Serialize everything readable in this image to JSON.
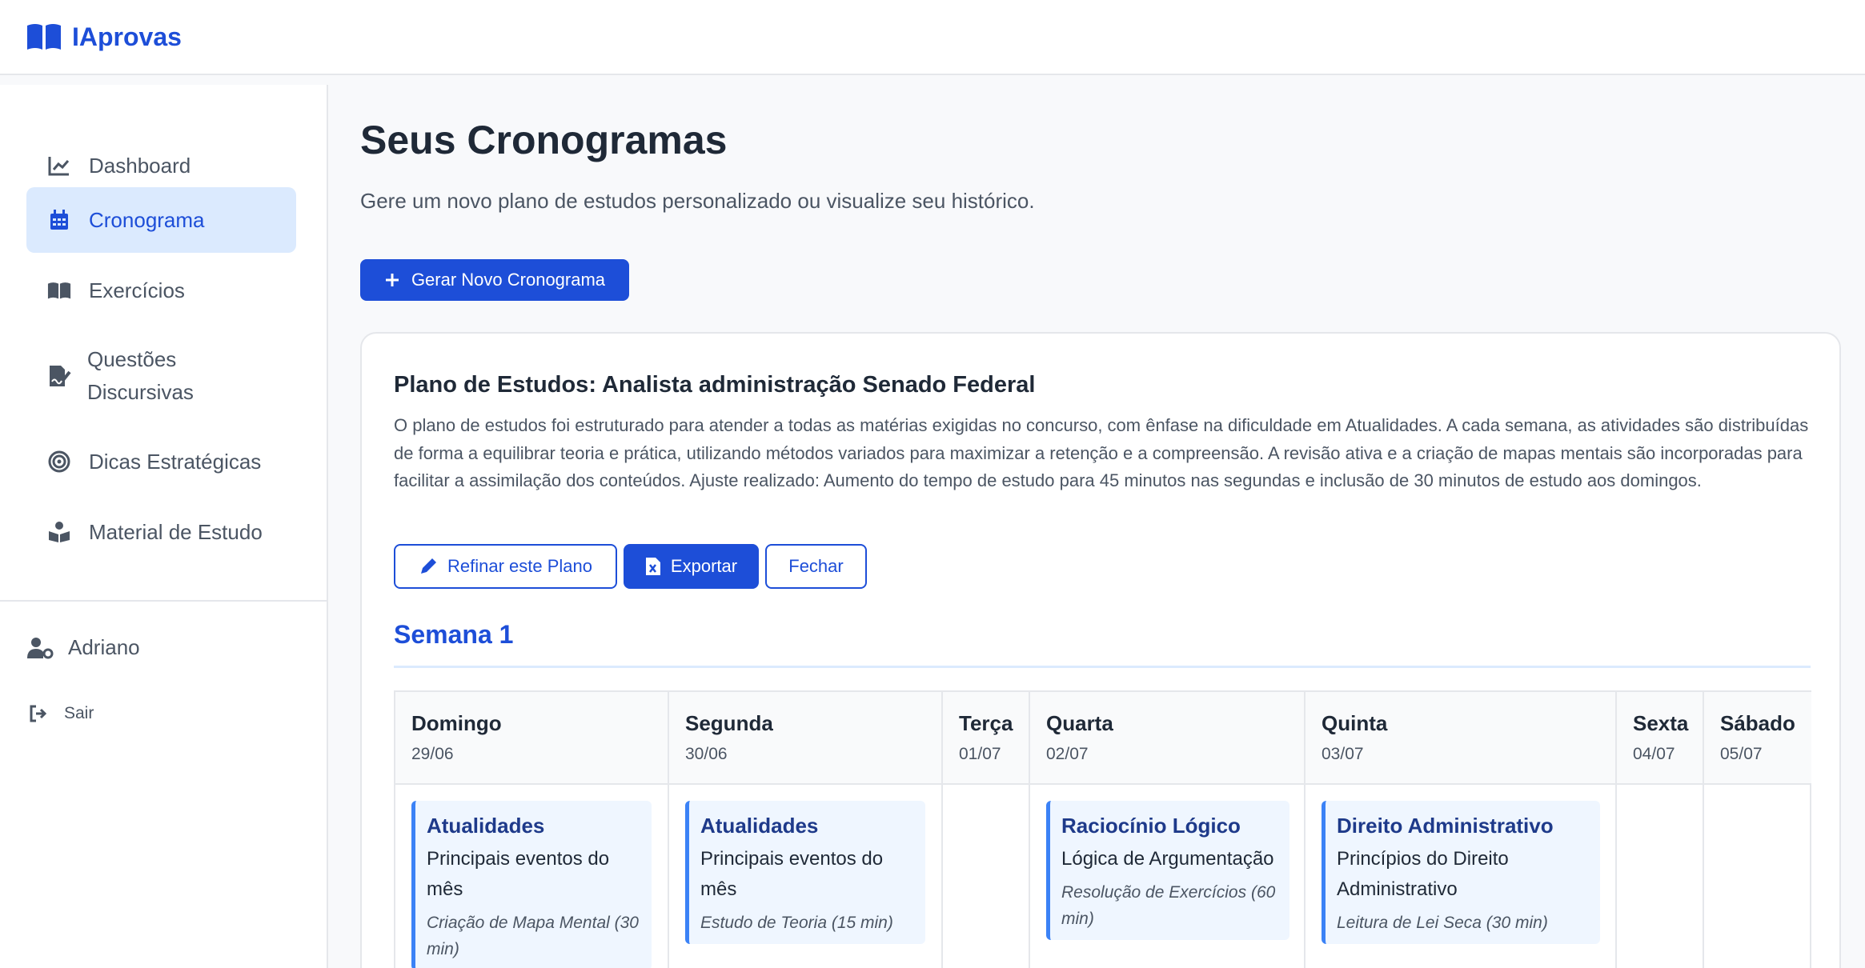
{
  "app": {
    "name": "IAprovas",
    "brand_color": "#1d4ed8"
  },
  "sidebar": {
    "items": [
      {
        "label": "Dashboard",
        "icon": "chart-line-icon"
      },
      {
        "label": "Cronograma",
        "icon": "calendar-icon",
        "active": true
      },
      {
        "label": "Exercícios",
        "icon": "book-open-icon"
      },
      {
        "label": "Questões Discursivas",
        "line1": "Questões",
        "line2": "Discursivas",
        "icon": "file-signature-icon"
      },
      {
        "label": "Dicas Estratégicas",
        "icon": "bullseye-icon"
      },
      {
        "label": "Material de Estudo",
        "icon": "book-reader-icon"
      }
    ],
    "user": {
      "name": "Adriano",
      "icon": "user-cog-icon"
    },
    "logout": {
      "label": "Sair",
      "icon": "sign-out-icon"
    }
  },
  "main": {
    "title": "Seus Cronogramas",
    "subtitle": "Gere um novo plano de estudos personalizado ou visualize seu histórico.",
    "new_button": "Gerar Novo Cronograma"
  },
  "plan": {
    "title": "Plano de Estudos: Analista administração Senado Federal",
    "description": "O plano de estudos foi estruturado para atender a todas as matérias exigidas no concurso, com ênfase na dificuldade em Atualidades. A cada semana, as atividades são distribuídas de forma a equilibrar teoria e prática, utilizando métodos variados para maximizar a retenção e a compreensão. A revisão ativa e a criação de mapas mentais são incorporadas para facilitar a assimilação dos conteúdos. Ajuste realizado: Aumento do tempo de estudo para 45 minutos nas segundas e inclusão de 30 minutos de estudo aos domingos.",
    "buttons": {
      "refine": "Refinar este Plano",
      "export": "Exportar",
      "close": "Fechar"
    },
    "week_title": "Semana 1",
    "days": [
      {
        "name": "Domingo",
        "date": "29/06",
        "task": {
          "subject": "Atualidades",
          "topic": "Principais eventos do mês",
          "method": "Criação de Mapa Mental (30 min)"
        }
      },
      {
        "name": "Segunda",
        "date": "30/06",
        "task": {
          "subject": "Atualidades",
          "topic": "Principais eventos do mês",
          "method": "Estudo de Teoria (15 min)"
        }
      },
      {
        "name": "Terça",
        "date": "01/07"
      },
      {
        "name": "Quarta",
        "date": "02/07",
        "task": {
          "subject": "Raciocínio Lógico",
          "topic": "Lógica de Argumentação",
          "method": "Resolução de Exercícios (60 min)"
        }
      },
      {
        "name": "Quinta",
        "date": "03/07",
        "task": {
          "subject": "Direito Administrativo",
          "topic": "Princípios do Direito Administrativo",
          "method": "Leitura de Lei Seca (30 min)"
        }
      },
      {
        "name": "Sexta",
        "date": "04/07"
      },
      {
        "name": "Sábado",
        "date": "05/07"
      }
    ]
  }
}
